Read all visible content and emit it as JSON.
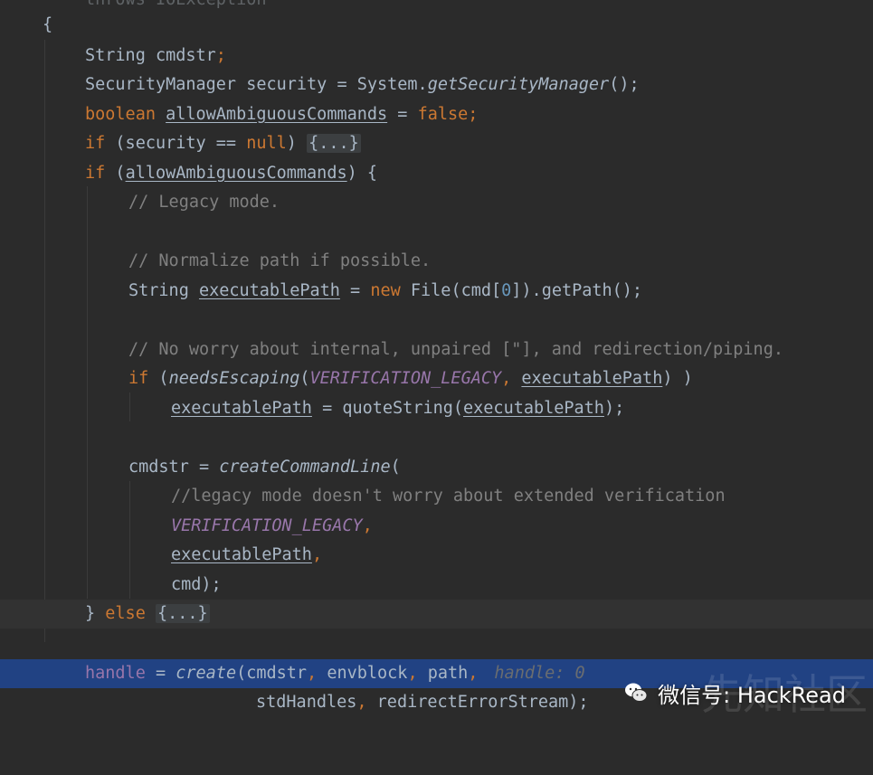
{
  "editor": {
    "top_partial": "throws IOException",
    "lines": {
      "brace_open": "{",
      "l_string_decl": [
        "String cmdstr",
        ";"
      ],
      "l_secmgr": [
        "SecurityManager security = System.",
        "getSecurityManager",
        "();"
      ],
      "l_boolean": [
        "boolean",
        "allowAmbiguousCommands",
        " = ",
        "false",
        ";"
      ],
      "l_if_security": [
        "if",
        " (security == ",
        "null",
        ") ",
        "{...}"
      ],
      "l_if_allow": [
        "if",
        " (",
        "allowAmbiguousCommands",
        ") {"
      ],
      "l_cm_legacy": "// Legacy mode.",
      "l_cm_normalize": "// Normalize path if possible.",
      "l_exec": [
        "String ",
        "executablePath",
        " = ",
        "new",
        " File(cmd[",
        "0",
        "]).getPath();"
      ],
      "l_cm_worry": "// No worry about internal, unpaired [\"], and redirection/piping.",
      "l_if_needs": [
        "if",
        " (",
        "needsEscaping",
        "(",
        "VERIFICATION_LEGACY",
        ", ",
        "executablePath",
        ") )"
      ],
      "l_quote": [
        "executablePath",
        " = quoteString(",
        "executablePath",
        ");"
      ],
      "l_cmdstr": [
        "cmdstr = ",
        "createCommandLine",
        "("
      ],
      "l_cm_legacy2": "//legacy mode doesn't worry about extended verification",
      "l_verif": [
        "VERIFICATION_LEGACY",
        ","
      ],
      "l_execarg": [
        "executablePath",
        ","
      ],
      "l_cmd": [
        "cmd",
        ");"
      ],
      "l_else": [
        "} ",
        "else",
        " ",
        "{...}"
      ],
      "l_handle": [
        "handle",
        " = ",
        "create",
        "(cmdstr",
        ", ",
        "envblock",
        ", ",
        "path",
        ","
      ],
      "l_handle_hint": "handle: 0",
      "l_std": [
        "stdHandles",
        ", ",
        "redirectErrorStream",
        ");"
      ]
    }
  },
  "watermark": {
    "label": "微信号: HackRead",
    "bg_text": "先知社区",
    "logo_icon": "wechat-icon"
  }
}
